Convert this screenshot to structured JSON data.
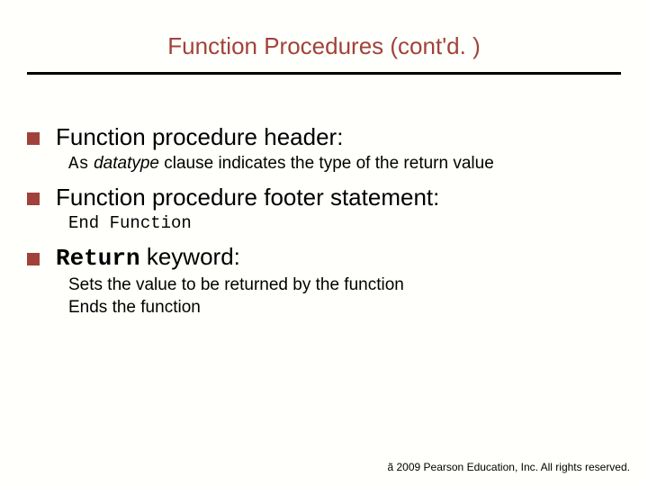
{
  "title": "Function Procedures (cont'd. )",
  "bullets": {
    "b1": {
      "text": "Function procedure header:",
      "sub_as": "As",
      "sub_dt": " datatype",
      "sub_rest": " clause indicates the type of the return value"
    },
    "b2": {
      "text": "Function procedure footer statement:",
      "sub_end": "End",
      "sub_func": " Function"
    },
    "b3": {
      "kw": "Return",
      "rest": " keyword:",
      "sub1": "Sets the value to be returned by the function",
      "sub2": "Ends the function"
    }
  },
  "footer": "ã 2009 Pearson Education, Inc.  All rights reserved."
}
